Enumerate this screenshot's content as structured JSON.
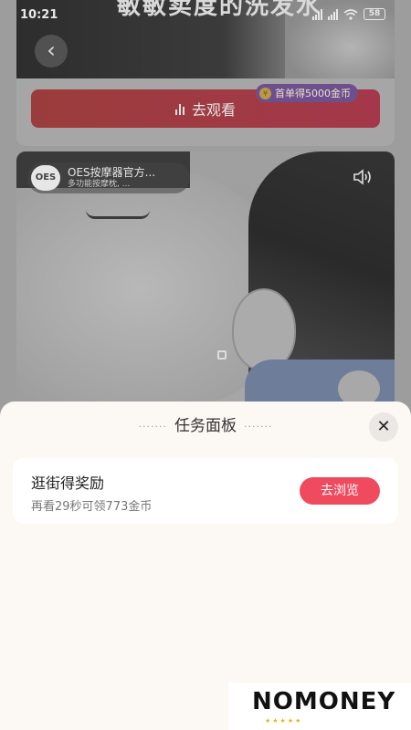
{
  "status_bar": {
    "time": "10:21",
    "battery": "58"
  },
  "feed": {
    "video1": {
      "caption": "敏敏卖度的洗发水",
      "watch_button_label": "去观看",
      "badge_text": "首单得5000金币"
    },
    "video2": {
      "store_logo": "OES",
      "store_name": "OES按摩器官方...",
      "store_desc": "多功能按摩枕, ..."
    }
  },
  "sheet": {
    "title": "任务面板",
    "task": {
      "title": "逛街得奖励",
      "subtitle": "再看29秒可领773金币",
      "button_label": "去浏览"
    }
  },
  "watermark": {
    "text": "NOMONEY"
  },
  "colors": {
    "accent": "#ef4a5e",
    "sheet_bg": "#fcf8f3",
    "badge_gold": "#e3b81a"
  },
  "icons": [
    "back-arrow-icon",
    "chart-icon",
    "coin-icon",
    "speaker-icon",
    "wifi-icon",
    "signal-icon",
    "battery-icon",
    "close-icon"
  ]
}
